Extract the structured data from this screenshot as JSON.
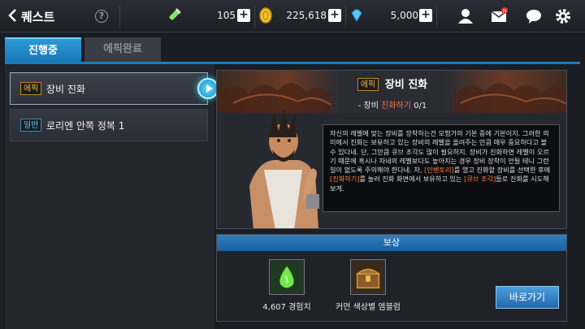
{
  "header": {
    "title": "퀘스트",
    "help_label": "?",
    "stamina_value": "105",
    "gold_value": "225,618",
    "gem_value": "5,000",
    "plus_label": "+",
    "mail_badge": "N"
  },
  "tabs": [
    {
      "label": "진행중",
      "active": true
    },
    {
      "label": "에픽완료",
      "active": false
    }
  ],
  "quests": [
    {
      "tag": "에픽",
      "name": "장비 진화"
    },
    {
      "tag": "일반",
      "name": "로리엔 안쪽 정복 1"
    }
  ],
  "detail": {
    "tag": "에픽",
    "title": "장비 진화",
    "sub_prefix": "- 장비 ",
    "sub_highlight": "진화하기",
    "sub_progress": "0/1",
    "dialog": [
      {
        "t": "자신의 레벨에 맞는 장비를 장착하는건 모험가의 기본 중에 기본이지.  그러한 의미에서 진화는 보유하고 있는 장비의 레벨을 올려주는 만큼 매우 중요하다고 볼 수 있다네. 단, 그만큼 큐브 조각도 많이 필요하지. 장비가 진화하면 레벨이 오르기 때문에 혹시나 자네의 레벨보다도 높아지는 경우 장비 장착이 안될 테니 그런일이 없도록 주의해야 한다네.  자, ",
        "hl": false
      },
      {
        "t": "[인벤토리]",
        "hl": true
      },
      {
        "t": "를 열고 진화할 장비를 선택한 후에 ",
        "hl": false
      },
      {
        "t": "[진화하기]",
        "hl": true
      },
      {
        "t": "를 눌러 진화 화면에서 보유하고 있는 ",
        "hl": false
      },
      {
        "t": "[큐브 조각]",
        "hl": true
      },
      {
        "t": "들로 진화를 시도해보게.",
        "hl": false
      }
    ]
  },
  "reward": {
    "header": "보상",
    "items": [
      {
        "label": "4,607 경험치",
        "icon": "exp-potion-icon"
      },
      {
        "label": "커먼 색상별 엠블럼",
        "icon": "treasure-chest-icon"
      }
    ],
    "go_button": "바로가기"
  },
  "colors": {
    "accent_blue": "#1b7bbd",
    "highlight_orange": "#ff7040",
    "epic_gold": "#f0b03a"
  }
}
